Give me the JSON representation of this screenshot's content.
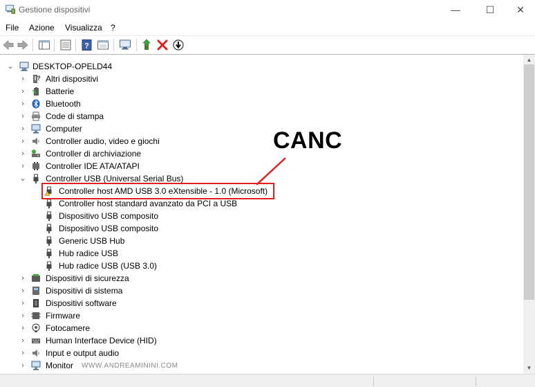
{
  "window": {
    "title": "Gestione dispositivi",
    "minimize_glyph": "—",
    "maximize_glyph": "☐",
    "close_glyph": "✕"
  },
  "menu": [
    "File",
    "Azione",
    "Visualizza",
    "?"
  ],
  "toolbar": {
    "icons": [
      "back-icon",
      "forward-icon",
      "console-tree-icon",
      "properties-icon",
      "help-icon",
      "view-icon",
      "scan-hardware-icon",
      "update-driver-icon",
      "uninstall-icon",
      "disable-icon"
    ],
    "uninstall_color": "#d9201f"
  },
  "tree": {
    "root": "DESKTOP-OPELD44",
    "categories_before": [
      {
        "label": "Altri dispositivi",
        "icon": "unknown-device-icon"
      },
      {
        "label": "Batterie",
        "icon": "battery-icon"
      },
      {
        "label": "Bluetooth",
        "icon": "bluetooth-icon"
      },
      {
        "label": "Code di stampa",
        "icon": "printer-icon"
      },
      {
        "label": "Computer",
        "icon": "computer-icon"
      },
      {
        "label": "Controller audio, video e giochi",
        "icon": "speaker-icon"
      },
      {
        "label": "Controller di archiviazione",
        "icon": "storage-icon"
      },
      {
        "label": "Controller IDE ATA/ATAPI",
        "icon": "ide-icon"
      }
    ],
    "usb_category": "Controller USB (Universal Serial Bus)",
    "usb_children": [
      "Controller host AMD USB 3.0 eXtensible - 1.0 (Microsoft)",
      "Controller host standard avanzato da PCI a USB",
      "Dispositivo USB composito",
      "Dispositivo USB composito",
      "Generic USB Hub",
      "Hub radice USB",
      "Hub radice USB (USB 3.0)"
    ],
    "categories_after": [
      {
        "label": "Dispositivi di sicurezza",
        "icon": "security-device-icon"
      },
      {
        "label": "Dispositivi di sistema",
        "icon": "system-device-icon"
      },
      {
        "label": "Dispositivi software",
        "icon": "software-device-icon"
      },
      {
        "label": "Firmware",
        "icon": "firmware-icon"
      },
      {
        "label": "Fotocamere",
        "icon": "camera-icon"
      },
      {
        "label": "Human Interface Device (HID)",
        "icon": "hid-icon"
      },
      {
        "label": "Input e output audio",
        "icon": "audio-io-icon"
      },
      {
        "label": "Monitor",
        "icon": "monitor-icon"
      }
    ]
  },
  "annotation": {
    "callout": "CANC",
    "color": "#e02020"
  },
  "watermark": "WWW.ANDREAMININI.COM"
}
